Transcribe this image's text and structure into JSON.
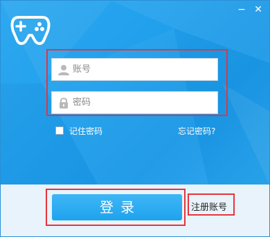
{
  "window": {
    "minimize_glyph": "−",
    "close_glyph": "✕"
  },
  "logo": {
    "icon": "gamepad-icon"
  },
  "form": {
    "account_placeholder": "账号",
    "account_value": "",
    "account_icon": "user-icon",
    "password_placeholder": "密码",
    "password_value": "",
    "password_icon": "lock-icon",
    "remember_label": "记住密码",
    "remember_checked": false,
    "forgot_label": "忘记密码?"
  },
  "actions": {
    "login_label": "登录",
    "register_label": "注册账号"
  },
  "colors": {
    "accent": "#21a0ec",
    "highlight_border": "#e8333b",
    "footer_bg": "#e8f3fb"
  }
}
